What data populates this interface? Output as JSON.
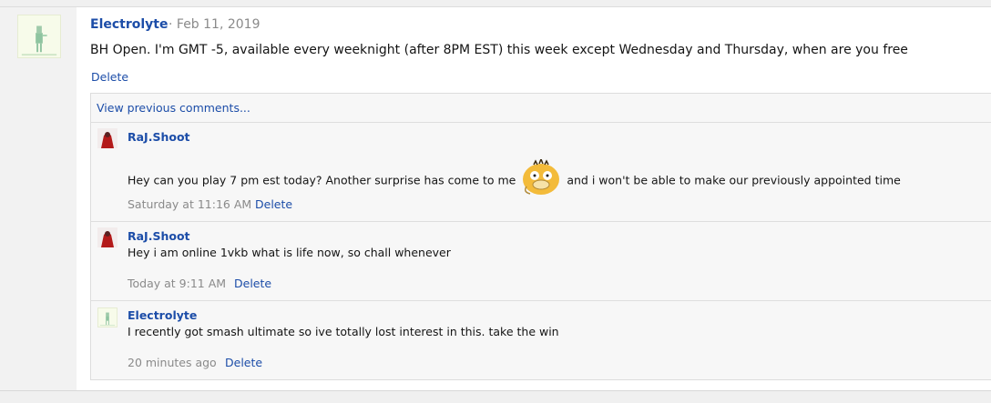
{
  "post": {
    "author": "Electrolyte",
    "date": "· Feb 11, 2019",
    "body": "BH Open. I'm GMT -5, available every weeknight (after 8PM EST) this week except Wednesday and Thursday, when are you free",
    "delete_label": "Delete",
    "avatar_icon": "electrolyte-avatar"
  },
  "comments_section": {
    "view_previous_label": "View previous comments...",
    "comments": [
      {
        "author": "RaJ.Shoot",
        "text_before": "Hey can you play 7 pm est today? Another surprise has come to me",
        "emote": "psyduck-emote",
        "text_after": "and i won't be able to make our previously appointed time",
        "time": "Saturday at 11:16 AM",
        "delete_label": "Delete"
      },
      {
        "author": "RaJ.Shoot",
        "text": "Hey i am online 1vkb what is life now, so chall whenever",
        "time": "Today at 9:11 AM",
        "delete_label": "Delete"
      },
      {
        "author": "Electrolyte",
        "text": "I recently got smash ultimate so ive totally lost interest in this. take the win",
        "time": "20 minutes ago",
        "delete_label": "Delete"
      }
    ]
  },
  "colors": {
    "link": "#1c4da8",
    "muted": "#8a8a8a",
    "panel_bg": "#f7f7f7"
  }
}
